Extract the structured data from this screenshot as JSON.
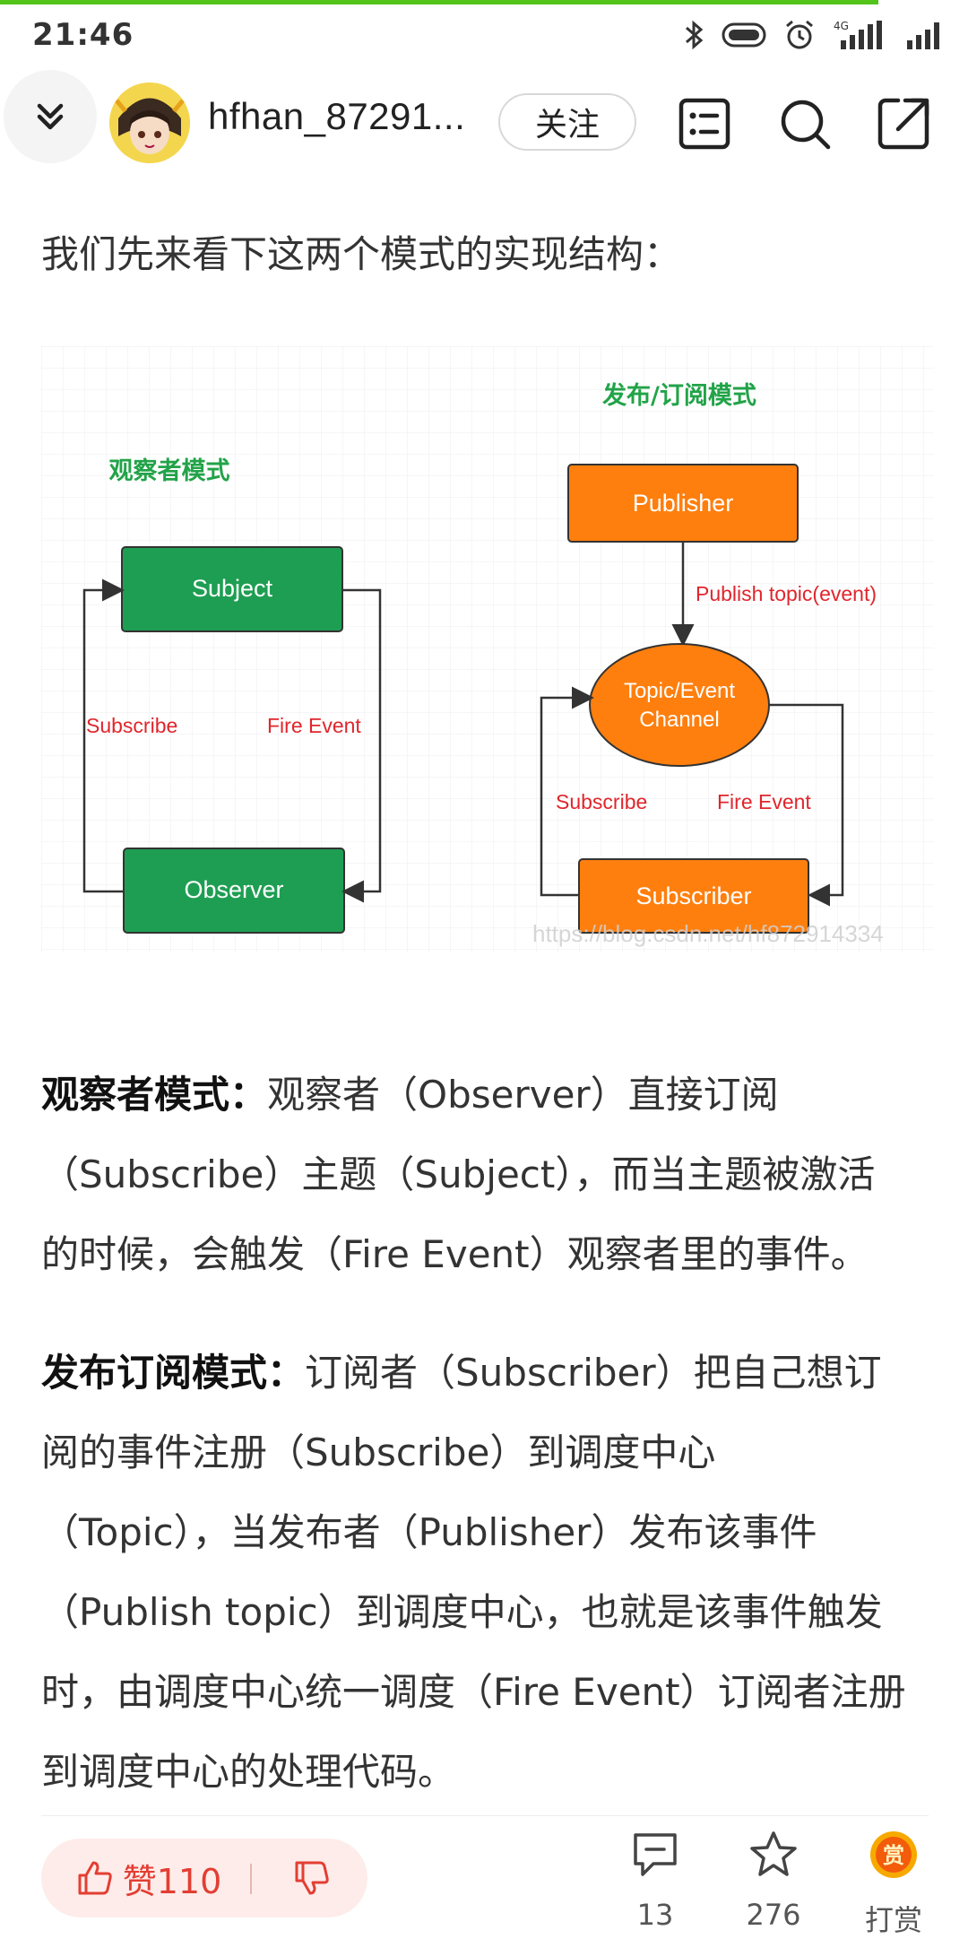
{
  "status_bar": {
    "time": "21:46",
    "network": "4G"
  },
  "header": {
    "username": "hfhan_87291...",
    "follow_label": "关注",
    "icons": [
      "collapse-icon",
      "avatar",
      "list-icon",
      "search-icon",
      "share-icon"
    ]
  },
  "article": {
    "intro": "我们先来看下这两个模式的实现结构：",
    "diagram": {
      "left_title": "观察者模式",
      "right_title": "发布/订阅模式",
      "subject": "Subject",
      "observer": "Observer",
      "publisher": "Publisher",
      "channel_line1": "Topic/Event",
      "channel_line2": "Channel",
      "subscriber": "Subscriber",
      "subscribe_left": "Subscribe",
      "fire_left": "Fire Event",
      "publish_topic": "Publish topic(event)",
      "subscribe_right": "Subscribe",
      "fire_right": "Fire Event",
      "watermark": "https://blog.csdn.net/hf872914334",
      "colors": {
        "green": "#1e9e52",
        "orange": "#ff7f0e",
        "red_text": "#e0262c",
        "green_text": "#22a348"
      }
    },
    "para1": {
      "label": "观察者模式：",
      "lines": [
        "观察者（Observer）直接订阅",
        "（Subscribe）主题（Subject），而当主题被激活",
        "的时候，会触发（Fire Event）观察者里的事件。"
      ]
    },
    "para2": {
      "label": "发布订阅模式：",
      "lines": [
        "订阅者（Subscriber）把自己想订",
        "阅的事件注册（Subscribe）到调度中心",
        "（Topic），当发布者（Publisher）发布该事件",
        "（Publish topic）到调度中心，也就是该事件触发",
        "时，由调度中心统一调度（Fire Event）订阅者注册",
        "到调度中心的处理代码。"
      ]
    }
  },
  "bottom_bar": {
    "like_label": "赞110",
    "comment_count": "13",
    "favorite_count": "276",
    "reward_label": "打赏",
    "reward_badge": "赏"
  }
}
